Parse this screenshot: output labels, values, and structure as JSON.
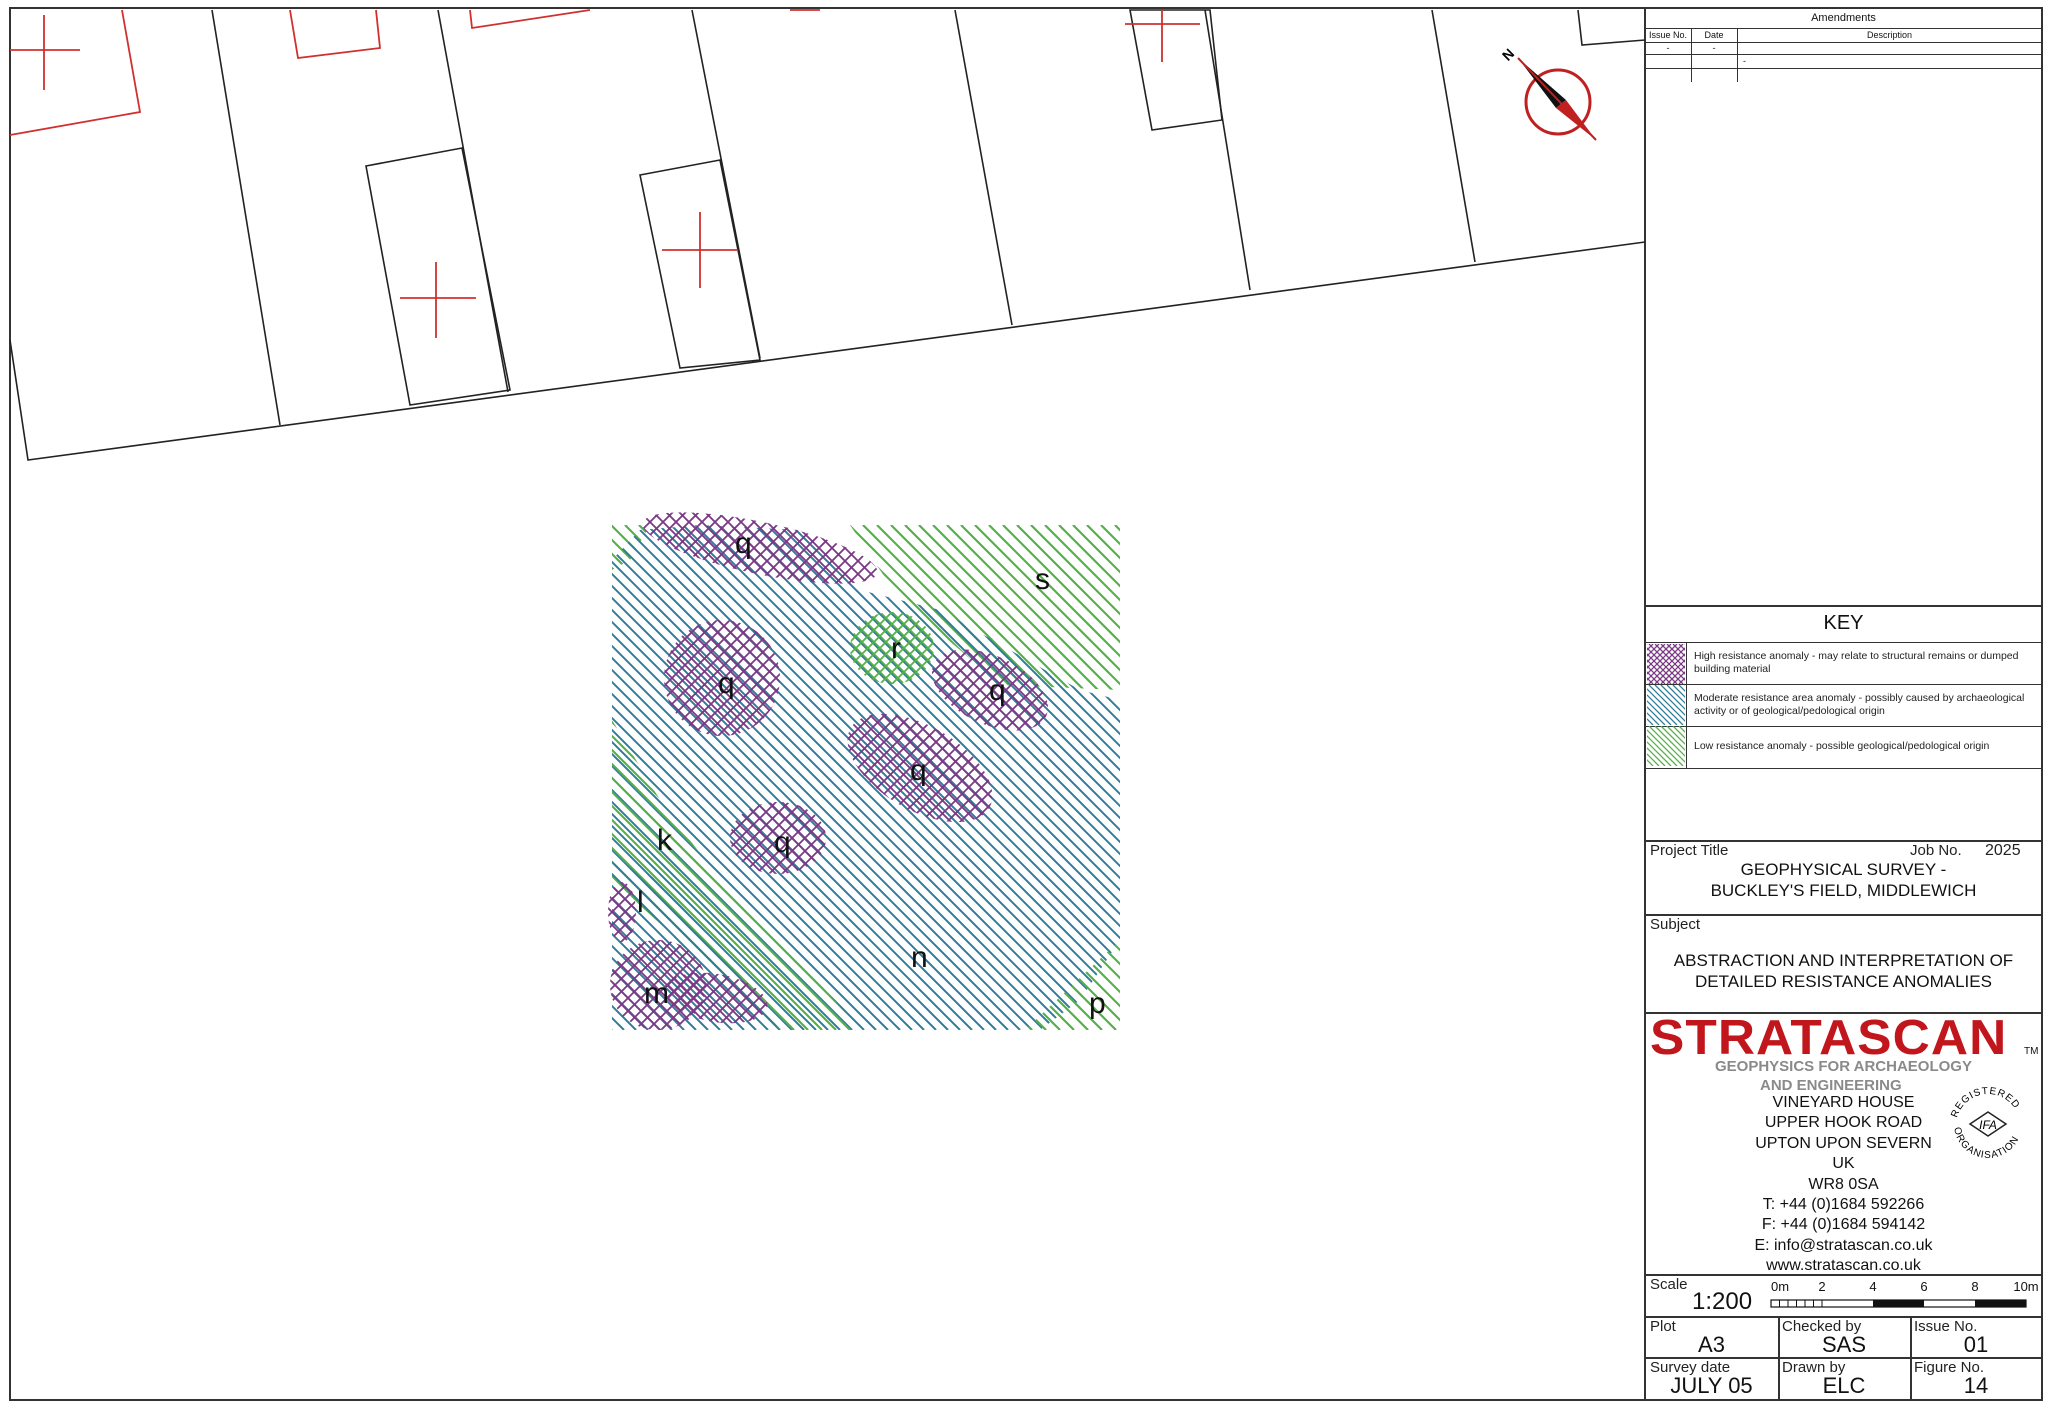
{
  "amendments": {
    "title": "Amendments",
    "columns": [
      "Issue No.",
      "Date",
      "Description"
    ],
    "rows": [
      [
        "-",
        "-",
        "-"
      ]
    ]
  },
  "north": {
    "label": "N"
  },
  "map": {
    "labels": [
      "q",
      "q",
      "q",
      "q",
      "q",
      "r",
      "s",
      "k",
      "l",
      "m",
      "n",
      "p"
    ],
    "colors": {
      "high": "#7b3a86",
      "moderate": "#2f7d9a",
      "low": "#56b04a",
      "grid_cross": "#d03030",
      "boundary": "#222222"
    }
  },
  "key": {
    "title": "KEY",
    "items": [
      {
        "type": "high",
        "text": "High resistance anomaly - may relate to structural remains or dumped building material"
      },
      {
        "type": "moderate",
        "text": "Moderate resistance area anomaly - possibly caused by archaeological activity or of geological/pedological origin"
      },
      {
        "type": "low",
        "text": "Low resistance anomaly - possible geological/pedological origin"
      }
    ]
  },
  "project": {
    "title_label": "Project Title",
    "job_label": "Job No.",
    "job_no": "2025",
    "title_line1": "GEOPHYSICAL SURVEY -",
    "title_line2": "BUCKLEY'S FIELD, MIDDLEWICH"
  },
  "subject": {
    "label": "Subject",
    "line1": "ABSTRACTION AND INTERPRETATION OF",
    "line2": "DETAILED RESISTANCE ANOMALIES"
  },
  "company": {
    "name": "STRATASCAN",
    "tm": "TM",
    "tagline1": "GEOPHYSICS FOR ARCHAEOLOGY",
    "tagline2": "AND ENGINEERING",
    "address": [
      "VINEYARD HOUSE",
      "UPPER HOOK ROAD",
      "UPTON UPON SEVERN",
      "UK",
      "WR8 0SA"
    ],
    "tel": "T: +44 (0)1684 592266",
    "fax": "F: +44 (0)1684 594142",
    "email": "E: info@stratascan.co.uk",
    "web": "www.stratascan.co.uk",
    "seal": {
      "top": "REGISTERED",
      "bottom": "ORGANISATION",
      "center": "IFA"
    }
  },
  "scale": {
    "label": "Scale",
    "value": "1:200",
    "ticks": [
      "0m",
      "2",
      "4",
      "6",
      "8",
      "10m"
    ]
  },
  "footer": {
    "plot_label": "Plot",
    "plot": "A3",
    "checked_label": "Checked by",
    "checked": "SAS",
    "issue_label": "Issue No.",
    "issue": "01",
    "survey_label": "Survey date",
    "survey": "JULY 05",
    "drawn_label": "Drawn by",
    "drawn": "ELC",
    "figure_label": "Figure No.",
    "figure": "14"
  }
}
